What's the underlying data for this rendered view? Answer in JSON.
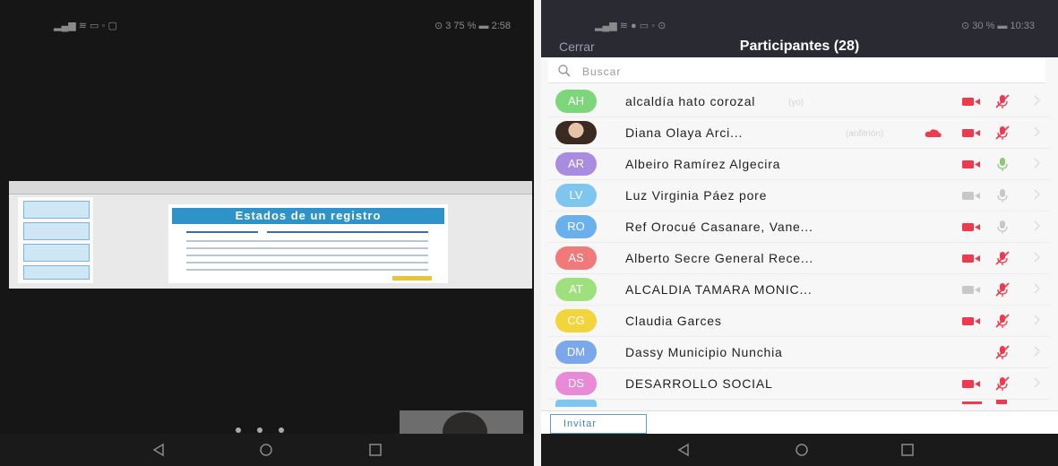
{
  "left_phone": {
    "status_right": "⊙ 3 75 %  ▬ 2:58",
    "slide_title": "Estados de un registro"
  },
  "right_phone": {
    "status_right": "⊙ 30 %  ▬ 10:33",
    "header": {
      "close_label": "Cerrar",
      "title": "Participantes (28)"
    },
    "search": {
      "placeholder": "Buscar"
    },
    "participants": [
      {
        "initials": "AH",
        "name": "alcaldía hato corozal",
        "tag": "(yo)",
        "color": "#7ed67a",
        "photo": false,
        "video_on": false,
        "mic_muted": true
      },
      {
        "initials": "",
        "name": "Diana Olaya Arci...",
        "tag": "(anfitrión)",
        "color": "#3b2a22",
        "photo": true,
        "video_on": false,
        "mic_muted": true
      },
      {
        "initials": "AR",
        "name": "Albeiro Ramírez Algecira",
        "tag": "",
        "color": "#a98ce0",
        "photo": false,
        "video_on": false,
        "mic_muted": false
      },
      {
        "initials": "LV",
        "name": "Luz Virginia Páez pore",
        "tag": "",
        "color": "#7ec6f0",
        "photo": false,
        "video_on": true,
        "mic_muted": false
      },
      {
        "initials": "RO",
        "name": "Ref Orocué Casanare, Vane...",
        "tag": "",
        "color": "#6ab0ec",
        "photo": false,
        "video_on": false,
        "mic_muted": false
      },
      {
        "initials": "AS",
        "name": "Alberto Secre General Rece...",
        "tag": "",
        "color": "#f07a7a",
        "photo": false,
        "video_on": false,
        "mic_muted": true
      },
      {
        "initials": "AT",
        "name": "ALCALDIA TAMARA MONIC...",
        "tag": "",
        "color": "#9ee07e",
        "photo": false,
        "video_on": true,
        "mic_muted": true
      },
      {
        "initials": "CG",
        "name": "Claudia Garces",
        "tag": "",
        "color": "#f2d53c",
        "photo": false,
        "video_on": false,
        "mic_muted": true
      },
      {
        "initials": "DM",
        "name": "Dassy Municipio Nunchia",
        "tag": "",
        "color": "#7aa8ea",
        "photo": false,
        "video_on": null,
        "mic_muted": true
      },
      {
        "initials": "DS",
        "name": "DESARROLLO SOCIAL",
        "tag": "",
        "color": "#e98ad8",
        "photo": false,
        "video_on": false,
        "mic_muted": true
      }
    ],
    "invite_label": "Invitar"
  },
  "colors": {
    "muted_red": "#ee3a4e",
    "active_gray": "#c8c8c8",
    "header_bg": "#2a2a33"
  }
}
